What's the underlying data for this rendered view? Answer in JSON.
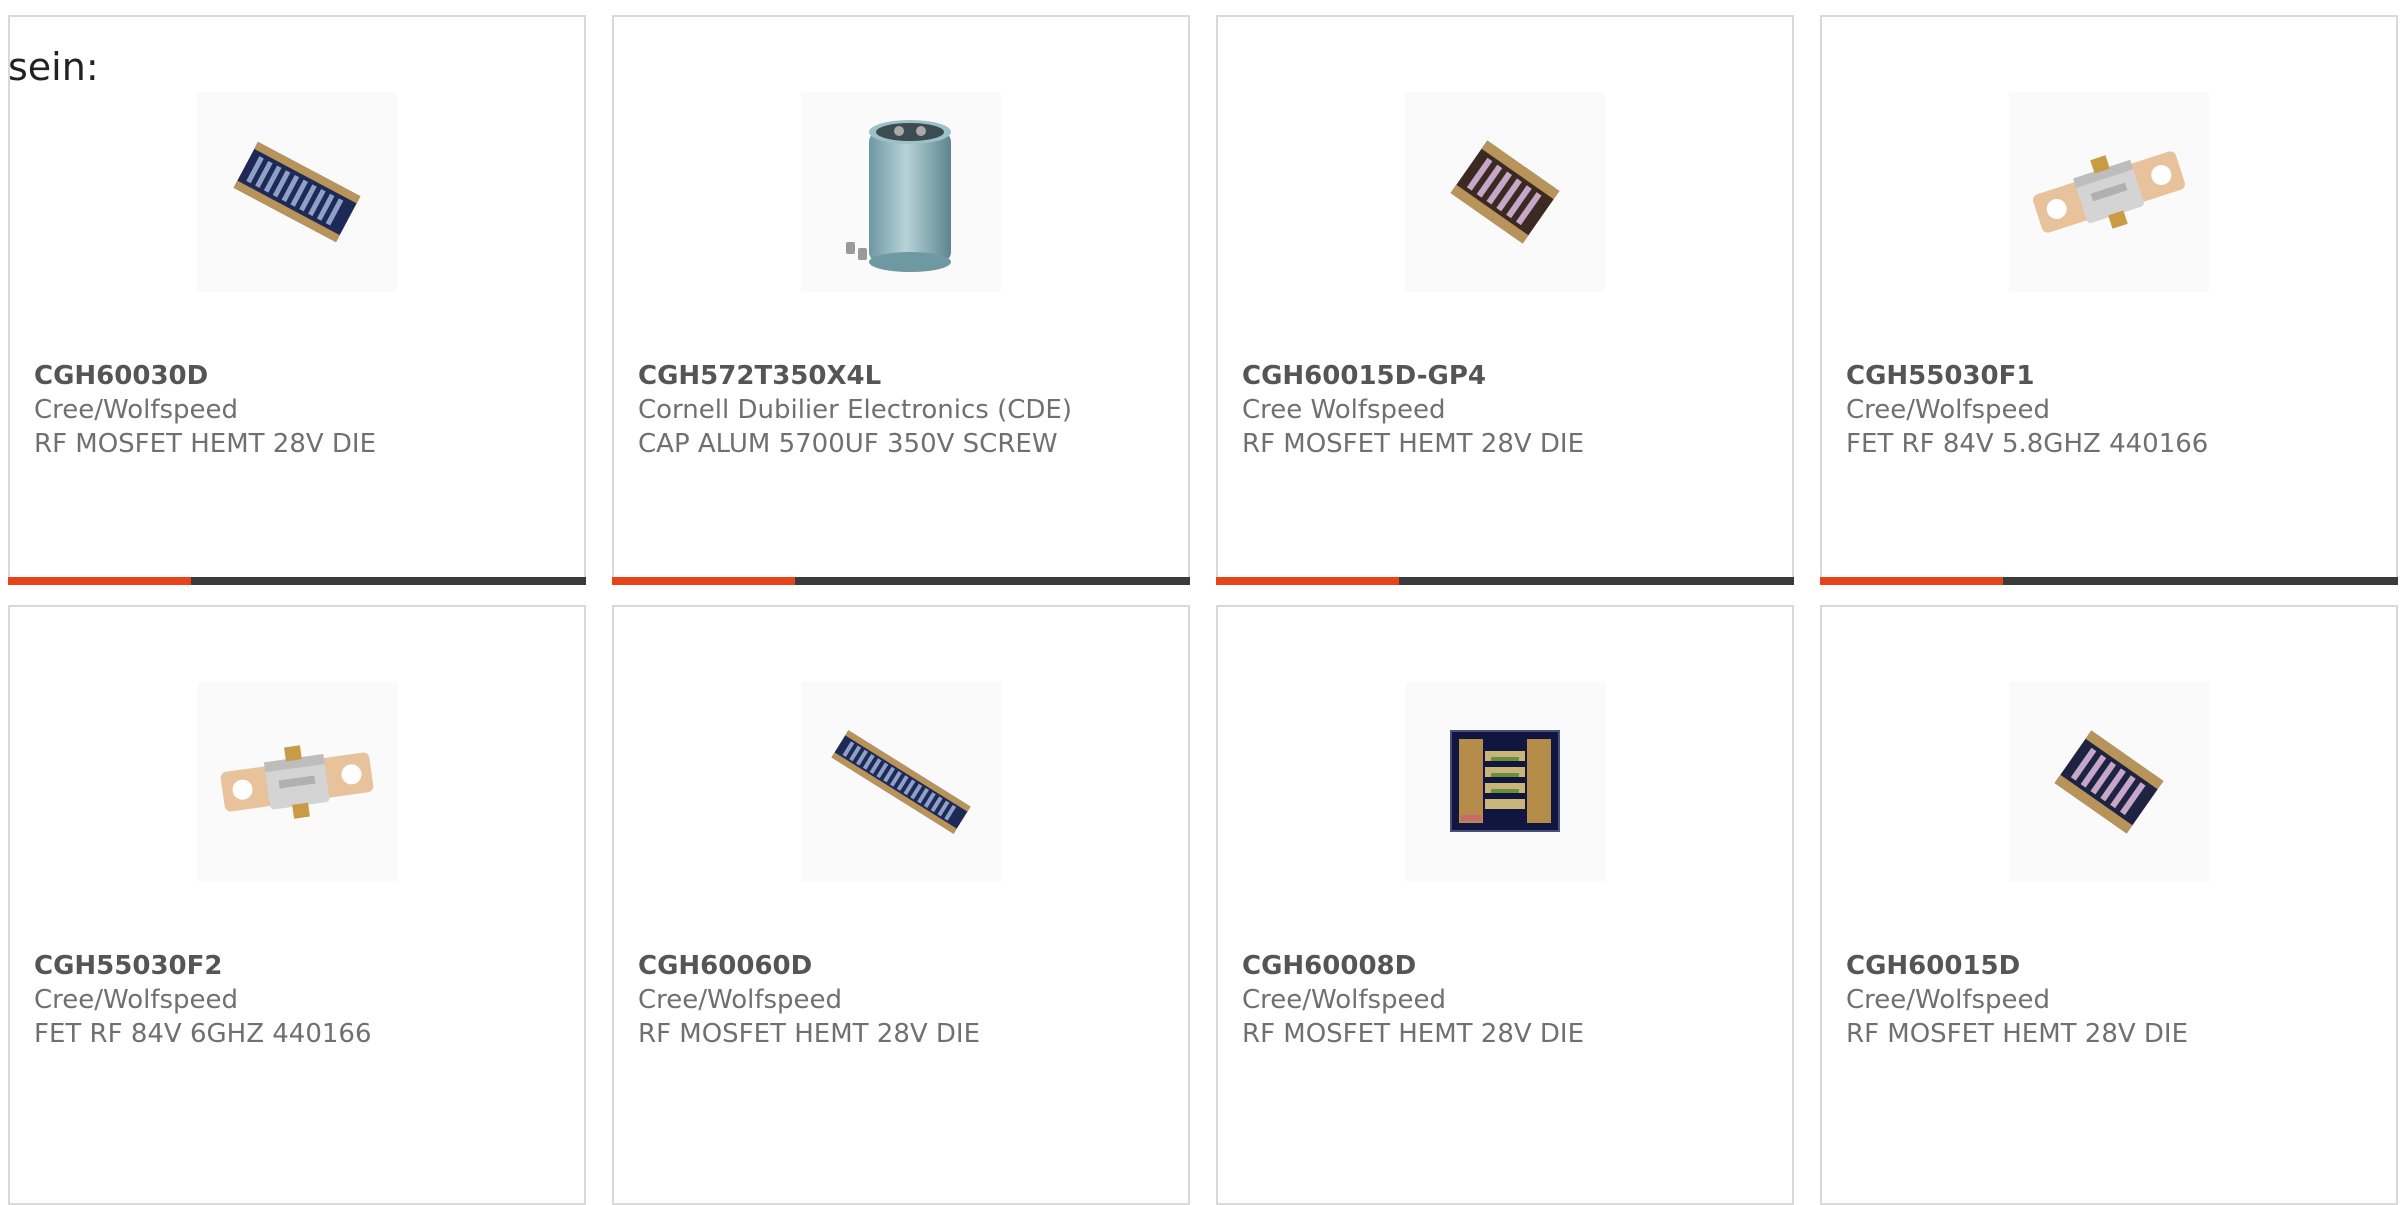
{
  "intro_text": "sein:",
  "colors": {
    "accent": "#e8441a",
    "bar": "#3b3b3b",
    "border": "#d9d9d9",
    "text": "#707070"
  },
  "products": [
    {
      "part": "CGH60030D",
      "manufacturer": "Cree/Wolfspeed",
      "description": "RF MOSFET HEMT 28V DIE",
      "image_icon": "die-chip-icon"
    },
    {
      "part": "CGH572T350X4L",
      "manufacturer": "Cornell Dubilier Electronics (CDE)",
      "description": "CAP ALUM 5700UF 350V SCREW",
      "image_icon": "capacitor-icon"
    },
    {
      "part": "CGH60015D-GP4",
      "manufacturer": "Cree Wolfspeed",
      "description": "RF MOSFET HEMT 28V DIE",
      "image_icon": "die-chip-icon"
    },
    {
      "part": "CGH55030F1",
      "manufacturer": "Cree/Wolfspeed",
      "description": "FET RF 84V 5.8GHZ 440166",
      "image_icon": "flange-package-icon"
    },
    {
      "part": "CGH55030F2",
      "manufacturer": "Cree/Wolfspeed",
      "description": "FET RF 84V 6GHZ 440166",
      "image_icon": "flange-package-icon"
    },
    {
      "part": "CGH60060D",
      "manufacturer": "Cree/Wolfspeed",
      "description": "RF MOSFET HEMT 28V DIE",
      "image_icon": "long-die-chip-icon"
    },
    {
      "part": "CGH60008D",
      "manufacturer": "Cree/Wolfspeed",
      "description": "RF MOSFET HEMT 28V DIE",
      "image_icon": "square-die-icon"
    },
    {
      "part": "CGH60015D",
      "manufacturer": "Cree/Wolfspeed",
      "description": "RF MOSFET HEMT 28V DIE",
      "image_icon": "die-chip-icon"
    }
  ]
}
